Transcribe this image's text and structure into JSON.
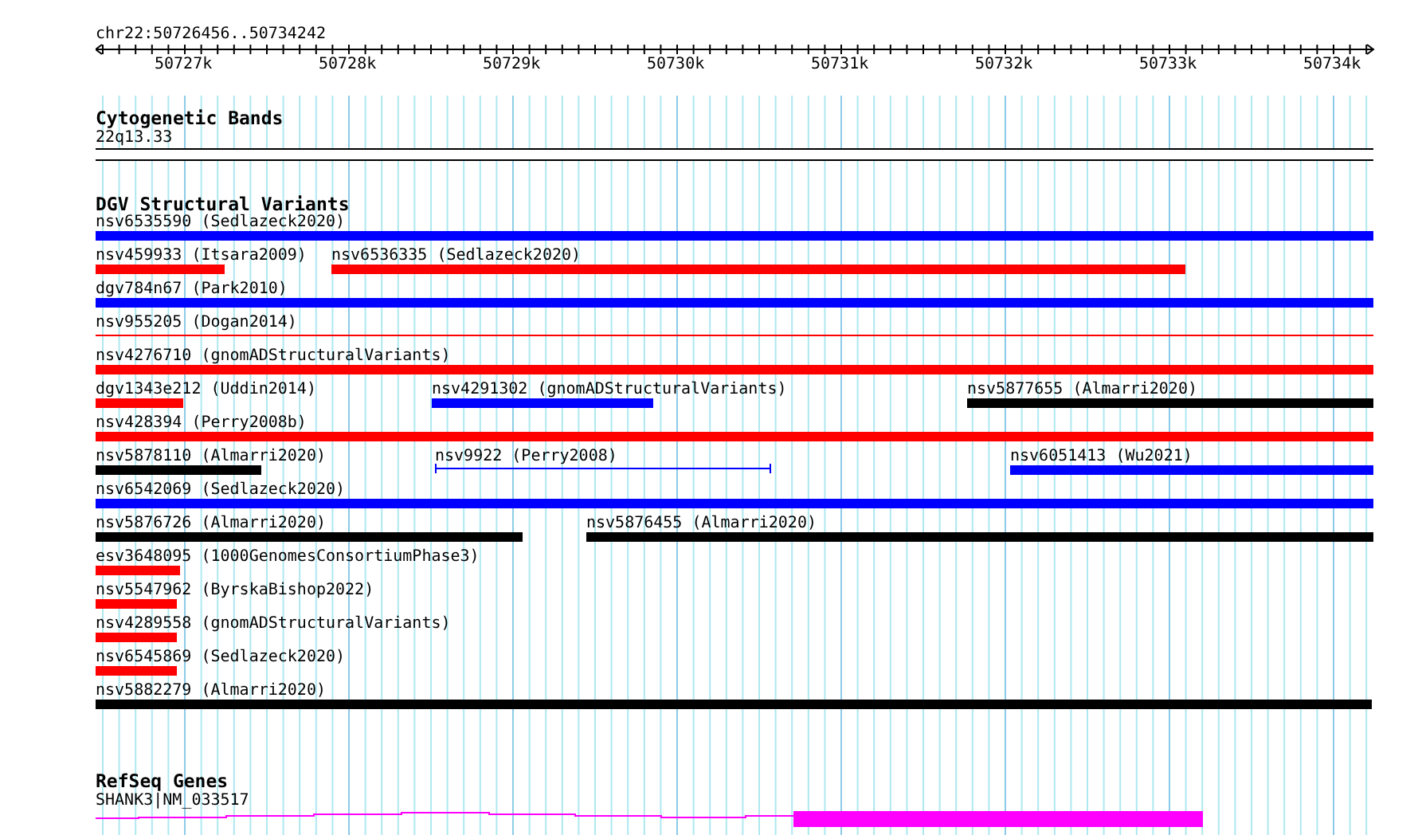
{
  "locus": "chr22:50726456..50734242",
  "ruler": {
    "ticks": [
      "50727k",
      "50728k",
      "50729k",
      "50730k",
      "50731k",
      "50732k",
      "50733k",
      "50734k"
    ]
  },
  "tracks": [
    {
      "kind": "bands",
      "title": "Cytogenetic Bands",
      "features": [
        {
          "label": "22q13.33"
        }
      ]
    },
    {
      "kind": "variants",
      "title": "DGV Structural Variants",
      "rows": [
        {
          "features": [
            {
              "label": "nsv6535590 (Sedlazeck2020)",
              "kind": "bar",
              "color": "#0000ff"
            }
          ]
        },
        {
          "features": [
            {
              "label": "nsv459933 (Itsara2009)",
              "kind": "bar",
              "color": "#ff0000"
            },
            {
              "label": "nsv6536335 (Sedlazeck2020)",
              "kind": "bar",
              "color": "#ff0000"
            }
          ]
        },
        {
          "features": [
            {
              "label": "dgv784n67 (Park2010)",
              "kind": "bar",
              "color": "#0000ff"
            }
          ]
        },
        {
          "features": [
            {
              "label": "nsv955205 (Dogan2014)",
              "kind": "line",
              "color": "#ff0000"
            }
          ]
        },
        {
          "features": [
            {
              "label": "nsv4276710 (gnomADStructuralVariants)",
              "kind": "bar",
              "color": "#ff0000"
            }
          ]
        },
        {
          "features": [
            {
              "label": "dgv1343e212 (Uddin2014)",
              "kind": "bar",
              "color": "#ff0000"
            },
            {
              "label": "nsv4291302 (gnomADStructuralVariants)",
              "kind": "bar",
              "color": "#0000ff"
            },
            {
              "label": "nsv5877655 (Almarri2020)",
              "kind": "bar",
              "color": "#000000"
            }
          ]
        },
        {
          "features": [
            {
              "label": "nsv428394 (Perry2008b)",
              "kind": "bar",
              "color": "#ff0000"
            }
          ]
        },
        {
          "features": [
            {
              "label": "nsv5878110 (Almarri2020)",
              "kind": "bar",
              "color": "#000000"
            },
            {
              "label": "nsv9922 (Perry2008)",
              "kind": "interval",
              "color": "#0000ff"
            },
            {
              "label": "nsv6051413 (Wu2021)",
              "kind": "bar",
              "color": "#0000ff"
            }
          ]
        },
        {
          "features": [
            {
              "label": "nsv6542069 (Sedlazeck2020)",
              "kind": "bar",
              "color": "#0000ff"
            }
          ]
        },
        {
          "features": [
            {
              "label": "nsv5876726 (Almarri2020)",
              "kind": "bar",
              "color": "#000000"
            },
            {
              "label": "nsv5876455 (Almarri2020)",
              "kind": "bar",
              "color": "#000000"
            }
          ]
        },
        {
          "features": [
            {
              "label": "esv3648095 (1000GenomesConsortiumPhase3)",
              "kind": "bar",
              "color": "#ff0000"
            }
          ]
        },
        {
          "features": [
            {
              "label": "nsv5547962 (ByrskaBishop2022)",
              "kind": "bar",
              "color": "#ff0000"
            }
          ]
        },
        {
          "features": [
            {
              "label": "nsv4289558 (gnomADStructuralVariants)",
              "kind": "bar",
              "color": "#ff0000"
            }
          ]
        },
        {
          "features": [
            {
              "label": "nsv6545869 (Sedlazeck2020)",
              "kind": "bar",
              "color": "#ff0000"
            }
          ]
        },
        {
          "features": [
            {
              "label": "nsv5882279 (Almarri2020)",
              "kind": "bar",
              "color": "#000000"
            }
          ]
        }
      ]
    },
    {
      "kind": "genes",
      "title": "RefSeq Genes",
      "features": [
        {
          "label": "SHANK3|NM_033517"
        }
      ]
    }
  ]
}
